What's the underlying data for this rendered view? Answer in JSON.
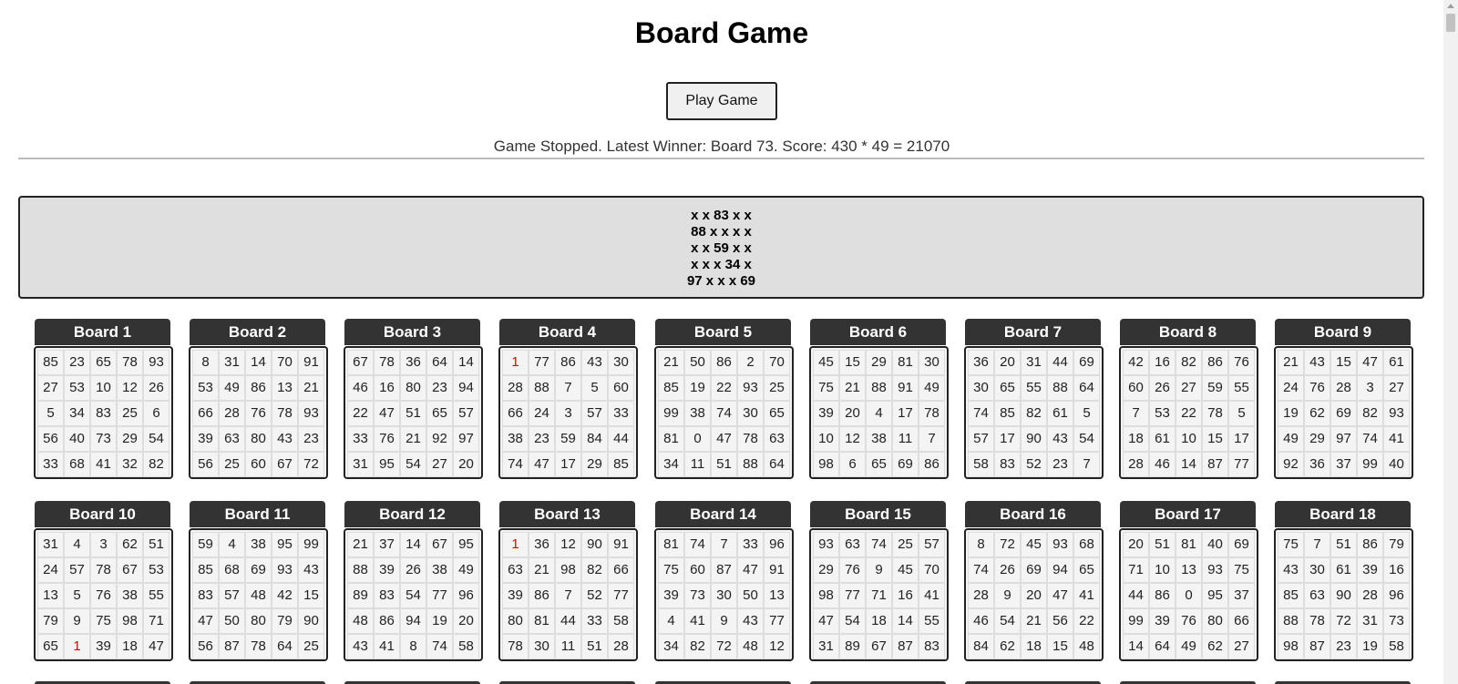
{
  "page": {
    "title": "Board Game",
    "play_button": "Play Game",
    "status": "Game Stopped. Latest Winner: Board 73. Score: 430 * 49 = 21070"
  },
  "winner_board": {
    "rows": [
      "x x 83 x x",
      "88 x x x x",
      "x x 59 x x",
      "x x x 34 x",
      "97 x x x 69"
    ]
  },
  "colors": {
    "board_header": "#333333",
    "marked_number": "#e00000",
    "winner_panel": "#dfdfdf"
  },
  "boards": [
    {
      "title": "Board 1",
      "rows": [
        [
          85,
          23,
          65,
          78,
          93
        ],
        [
          27,
          53,
          10,
          12,
          26
        ],
        [
          5,
          34,
          83,
          25,
          6
        ],
        [
          56,
          40,
          73,
          29,
          54
        ],
        [
          33,
          68,
          41,
          32,
          82
        ]
      ],
      "marked": []
    },
    {
      "title": "Board 2",
      "rows": [
        [
          8,
          31,
          14,
          70,
          91
        ],
        [
          53,
          49,
          86,
          13,
          21
        ],
        [
          66,
          28,
          76,
          78,
          93
        ],
        [
          39,
          63,
          80,
          43,
          23
        ],
        [
          56,
          25,
          60,
          67,
          72
        ]
      ],
      "marked": []
    },
    {
      "title": "Board 3",
      "rows": [
        [
          67,
          78,
          36,
          64,
          14
        ],
        [
          46,
          16,
          80,
          23,
          94
        ],
        [
          22,
          47,
          51,
          65,
          57
        ],
        [
          33,
          76,
          21,
          92,
          97
        ],
        [
          31,
          95,
          54,
          27,
          20
        ]
      ],
      "marked": []
    },
    {
      "title": "Board 4",
      "rows": [
        [
          1,
          77,
          86,
          43,
          30
        ],
        [
          28,
          88,
          7,
          5,
          60
        ],
        [
          66,
          24,
          3,
          57,
          33
        ],
        [
          38,
          23,
          59,
          84,
          44
        ],
        [
          74,
          47,
          17,
          29,
          85
        ]
      ],
      "marked": [
        [
          0,
          0
        ]
      ]
    },
    {
      "title": "Board 5",
      "rows": [
        [
          21,
          50,
          86,
          2,
          70
        ],
        [
          85,
          19,
          22,
          93,
          25
        ],
        [
          99,
          38,
          74,
          30,
          65
        ],
        [
          81,
          0,
          47,
          78,
          63
        ],
        [
          34,
          11,
          51,
          88,
          64
        ]
      ],
      "marked": []
    },
    {
      "title": "Board 6",
      "rows": [
        [
          45,
          15,
          29,
          81,
          30
        ],
        [
          75,
          21,
          88,
          91,
          49
        ],
        [
          39,
          20,
          4,
          17,
          78
        ],
        [
          10,
          12,
          38,
          11,
          7
        ],
        [
          98,
          6,
          65,
          69,
          86
        ]
      ],
      "marked": []
    },
    {
      "title": "Board 7",
      "rows": [
        [
          36,
          20,
          31,
          44,
          69
        ],
        [
          30,
          65,
          55,
          88,
          64
        ],
        [
          74,
          85,
          82,
          61,
          5
        ],
        [
          57,
          17,
          90,
          43,
          54
        ],
        [
          58,
          83,
          52,
          23,
          7
        ]
      ],
      "marked": []
    },
    {
      "title": "Board 8",
      "rows": [
        [
          42,
          16,
          82,
          86,
          76
        ],
        [
          60,
          26,
          27,
          59,
          55
        ],
        [
          7,
          53,
          22,
          78,
          5
        ],
        [
          18,
          61,
          10,
          15,
          17
        ],
        [
          28,
          46,
          14,
          87,
          77
        ]
      ],
      "marked": []
    },
    {
      "title": "Board 9",
      "rows": [
        [
          21,
          43,
          15,
          47,
          61
        ],
        [
          24,
          76,
          28,
          3,
          27
        ],
        [
          19,
          62,
          69,
          82,
          93
        ],
        [
          49,
          29,
          97,
          74,
          41
        ],
        [
          92,
          36,
          37,
          99,
          40
        ]
      ],
      "marked": []
    },
    {
      "title": "Board 10",
      "rows": [
        [
          31,
          4,
          3,
          62,
          51
        ],
        [
          24,
          57,
          78,
          67,
          53
        ],
        [
          13,
          5,
          76,
          38,
          55
        ],
        [
          79,
          9,
          75,
          98,
          71
        ],
        [
          65,
          1,
          39,
          18,
          47
        ]
      ],
      "marked": [
        [
          4,
          1
        ]
      ]
    },
    {
      "title": "Board 11",
      "rows": [
        [
          59,
          4,
          38,
          95,
          99
        ],
        [
          85,
          68,
          69,
          93,
          43
        ],
        [
          83,
          57,
          48,
          42,
          15
        ],
        [
          47,
          50,
          80,
          79,
          90
        ],
        [
          56,
          87,
          78,
          64,
          25
        ]
      ],
      "marked": []
    },
    {
      "title": "Board 12",
      "rows": [
        [
          21,
          37,
          14,
          67,
          95
        ],
        [
          88,
          39,
          26,
          38,
          49
        ],
        [
          89,
          83,
          54,
          77,
          96
        ],
        [
          48,
          86,
          94,
          19,
          20
        ],
        [
          43,
          41,
          8,
          74,
          58
        ]
      ],
      "marked": []
    },
    {
      "title": "Board 13",
      "rows": [
        [
          1,
          36,
          12,
          90,
          91
        ],
        [
          63,
          21,
          98,
          82,
          66
        ],
        [
          39,
          86,
          7,
          52,
          77
        ],
        [
          80,
          81,
          44,
          33,
          58
        ],
        [
          78,
          30,
          11,
          51,
          28
        ]
      ],
      "marked": [
        [
          0,
          0
        ]
      ]
    },
    {
      "title": "Board 14",
      "rows": [
        [
          81,
          74,
          7,
          33,
          96
        ],
        [
          75,
          60,
          87,
          47,
          91
        ],
        [
          39,
          73,
          30,
          50,
          13
        ],
        [
          4,
          41,
          9,
          43,
          77
        ],
        [
          34,
          82,
          72,
          48,
          12
        ]
      ],
      "marked": []
    },
    {
      "title": "Board 15",
      "rows": [
        [
          93,
          63,
          74,
          25,
          57
        ],
        [
          29,
          76,
          9,
          45,
          70
        ],
        [
          98,
          77,
          71,
          16,
          41
        ],
        [
          47,
          54,
          18,
          14,
          55
        ],
        [
          31,
          89,
          67,
          87,
          83
        ]
      ],
      "marked": []
    },
    {
      "title": "Board 16",
      "rows": [
        [
          8,
          72,
          45,
          93,
          68
        ],
        [
          74,
          26,
          69,
          94,
          65
        ],
        [
          28,
          9,
          20,
          47,
          41
        ],
        [
          46,
          54,
          21,
          56,
          22
        ],
        [
          84,
          62,
          18,
          15,
          48
        ]
      ],
      "marked": []
    },
    {
      "title": "Board 17",
      "rows": [
        [
          20,
          51,
          81,
          40,
          69
        ],
        [
          71,
          10,
          13,
          93,
          75
        ],
        [
          44,
          86,
          0,
          95,
          37
        ],
        [
          99,
          39,
          76,
          80,
          66
        ],
        [
          14,
          64,
          49,
          62,
          27
        ]
      ],
      "marked": []
    },
    {
      "title": "Board 18",
      "rows": [
        [
          75,
          7,
          51,
          86,
          79
        ],
        [
          43,
          30,
          61,
          39,
          16
        ],
        [
          85,
          63,
          90,
          28,
          96
        ],
        [
          88,
          78,
          72,
          31,
          73
        ],
        [
          98,
          87,
          23,
          19,
          58
        ]
      ],
      "marked": []
    }
  ]
}
